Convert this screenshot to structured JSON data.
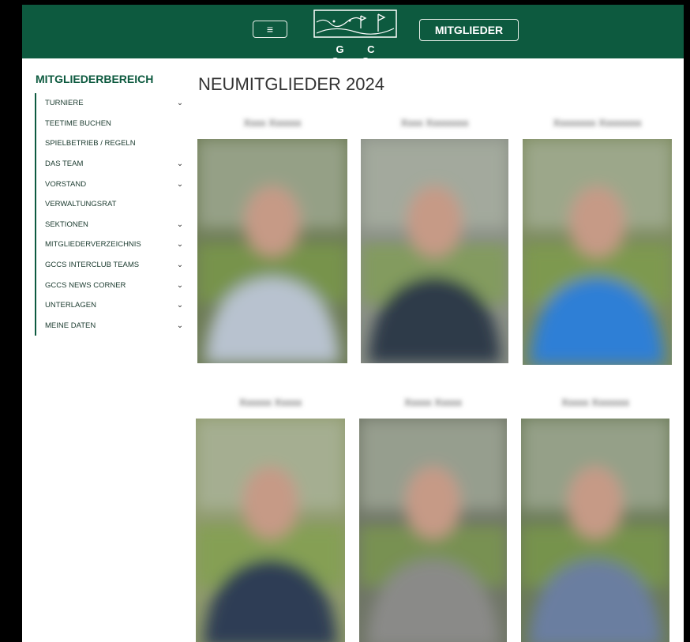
{
  "header": {
    "menu_icon": "hamburger-icon",
    "logo_text": "G C C S",
    "members_button": "MITGLIEDER",
    "bg_color": "#0d5a3f"
  },
  "sidebar": {
    "title": "MITGLIEDERBEREICH",
    "items": [
      {
        "label": "TURNIERE",
        "has_submenu": true
      },
      {
        "label": "TEETIME BUCHEN",
        "has_submenu": false
      },
      {
        "label": "SPIELBETRIEB / REGELN",
        "has_submenu": false
      },
      {
        "label": "DAS TEAM",
        "has_submenu": true
      },
      {
        "label": "VORSTAND",
        "has_submenu": true
      },
      {
        "label": "VERWALTUNGSRAT",
        "has_submenu": false
      },
      {
        "label": "SEKTIONEN",
        "has_submenu": true
      },
      {
        "label": "MITGLIEDERVERZEICHNIS",
        "has_submenu": true
      },
      {
        "label": "GCCS INTERCLUB TEAMS",
        "has_submenu": true
      },
      {
        "label": "GCCS NEWS CORNER",
        "has_submenu": true
      },
      {
        "label": "UNTERLAGEN",
        "has_submenu": true
      },
      {
        "label": "MEINE DATEN",
        "has_submenu": true
      }
    ]
  },
  "main": {
    "title": "NEUMITGLIEDER 2024",
    "members": [
      {
        "name": "Xxxx Xxxxxx",
        "bg": "#6d7b55",
        "shirt": "#b8c2cf"
      },
      {
        "name": "Xxxx Xxxxxxxx",
        "bg": "#8a8f86",
        "shirt": "#2e3a4a"
      },
      {
        "name": "Xxxxxxxx Xxxxxxxx",
        "bg": "#7c8a5e",
        "shirt": "#2f7fd6"
      },
      {
        "name": "Xxxxxx Xxxxx",
        "bg": "#8f9a6c",
        "shirt": "#2f3c55"
      },
      {
        "name": "Xxxxx Xxxxx",
        "bg": "#6f7566",
        "shirt": "#8a8a88"
      },
      {
        "name": "Xxxxx Xxxxxxx",
        "bg": "#6b7a58",
        "shirt": "#6a7ea0"
      }
    ]
  }
}
